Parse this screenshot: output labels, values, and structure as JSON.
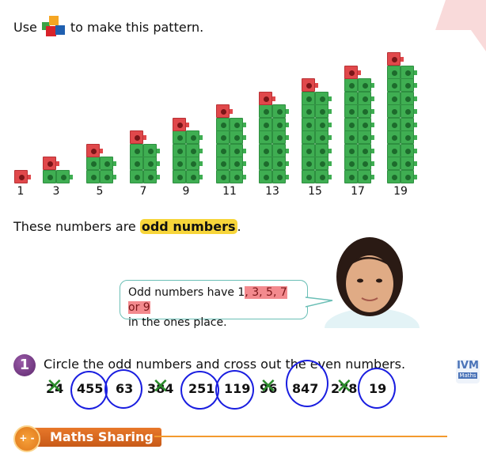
{
  "intro": {
    "before": "Use",
    "after": "to make this pattern.",
    "icon": "linking-cubes-icon"
  },
  "pattern": {
    "values": [
      1,
      3,
      5,
      7,
      9,
      11,
      13,
      15,
      17,
      19
    ],
    "colors": {
      "green": "#3fae52",
      "red": "#e0484b"
    }
  },
  "odd_statement": {
    "before": "These numbers are",
    "highlight": "odd numbers",
    "after": "."
  },
  "speech": {
    "line1_before": "Odd numbers have 1",
    "line1_highlight": ", 3, 5, 7 or 9",
    "line2": "in the ones place."
  },
  "question": {
    "number": "1",
    "text": "Circle the odd numbers and cross out the even numbers.",
    "items": [
      {
        "value": "24",
        "mark": "cross"
      },
      {
        "value": "455",
        "mark": "circle"
      },
      {
        "value": "63",
        "mark": "circle"
      },
      {
        "value": "384",
        "mark": "cross"
      },
      {
        "value": "251",
        "mark": "circle"
      },
      {
        "value": "119",
        "mark": "circle"
      },
      {
        "value": "96",
        "mark": "cross"
      },
      {
        "value": "847",
        "mark": "circle"
      },
      {
        "value": "278",
        "mark": "cross"
      },
      {
        "value": "19",
        "mark": "circle"
      }
    ],
    "circle_color": "#1a1ee0",
    "cross_color": "#2b8a2b"
  },
  "logo": {
    "top": "IVM",
    "bottom": "Maths"
  },
  "section": {
    "label": "Maths Sharing",
    "icon": "+ -",
    "accent": "#e8782a"
  }
}
